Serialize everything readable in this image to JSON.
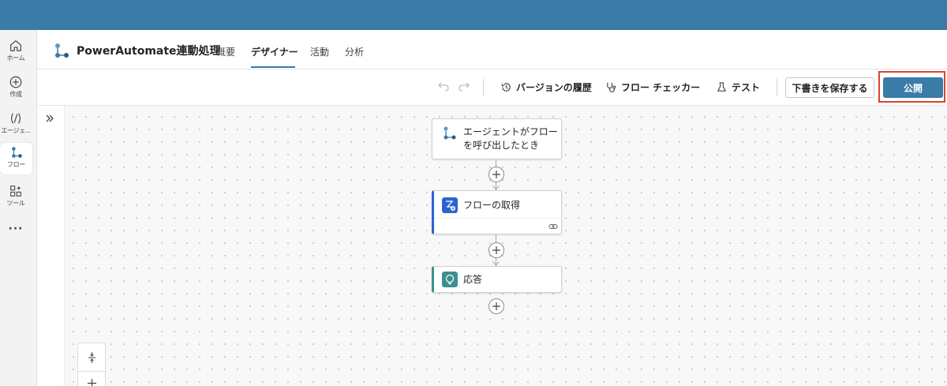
{
  "rail": {
    "items": [
      {
        "label": "ホーム",
        "icon": "home-icon"
      },
      {
        "label": "作成",
        "icon": "plus-circle-icon"
      },
      {
        "label": "エージェ...",
        "icon": "agent-icon"
      },
      {
        "label": "フロー",
        "icon": "flow-icon"
      },
      {
        "label": "ツール",
        "icon": "tools-icon"
      }
    ],
    "more_label": "···"
  },
  "header": {
    "title": "PowerAutomate連動処理",
    "tabs": [
      {
        "label": "概要"
      },
      {
        "label": "デザイナー"
      },
      {
        "label": "活動"
      },
      {
        "label": "分析"
      }
    ],
    "active_tab": "デザイナー"
  },
  "toolbar": {
    "version_history": "バージョンの履歴",
    "flow_checker": "フロー チェッカー",
    "test": "テスト",
    "save_draft": "下書きを保存する",
    "publish": "公開"
  },
  "canvas": {
    "nodes": [
      {
        "title_line1": "エージェントがフロー",
        "title_line2": "を呼び出したとき",
        "icon": "flow-trigger-icon"
      },
      {
        "title": "フローの取得",
        "icon": "get-flow-icon"
      },
      {
        "title": "応答",
        "icon": "respond-icon"
      }
    ]
  },
  "colors": {
    "topbar": "#3a7ba7",
    "accent": "#3a7ba7",
    "highlight": "#d9452f",
    "node_accent_blue": "#2b64d1",
    "node_accent_teal": "#3d8f8f"
  }
}
